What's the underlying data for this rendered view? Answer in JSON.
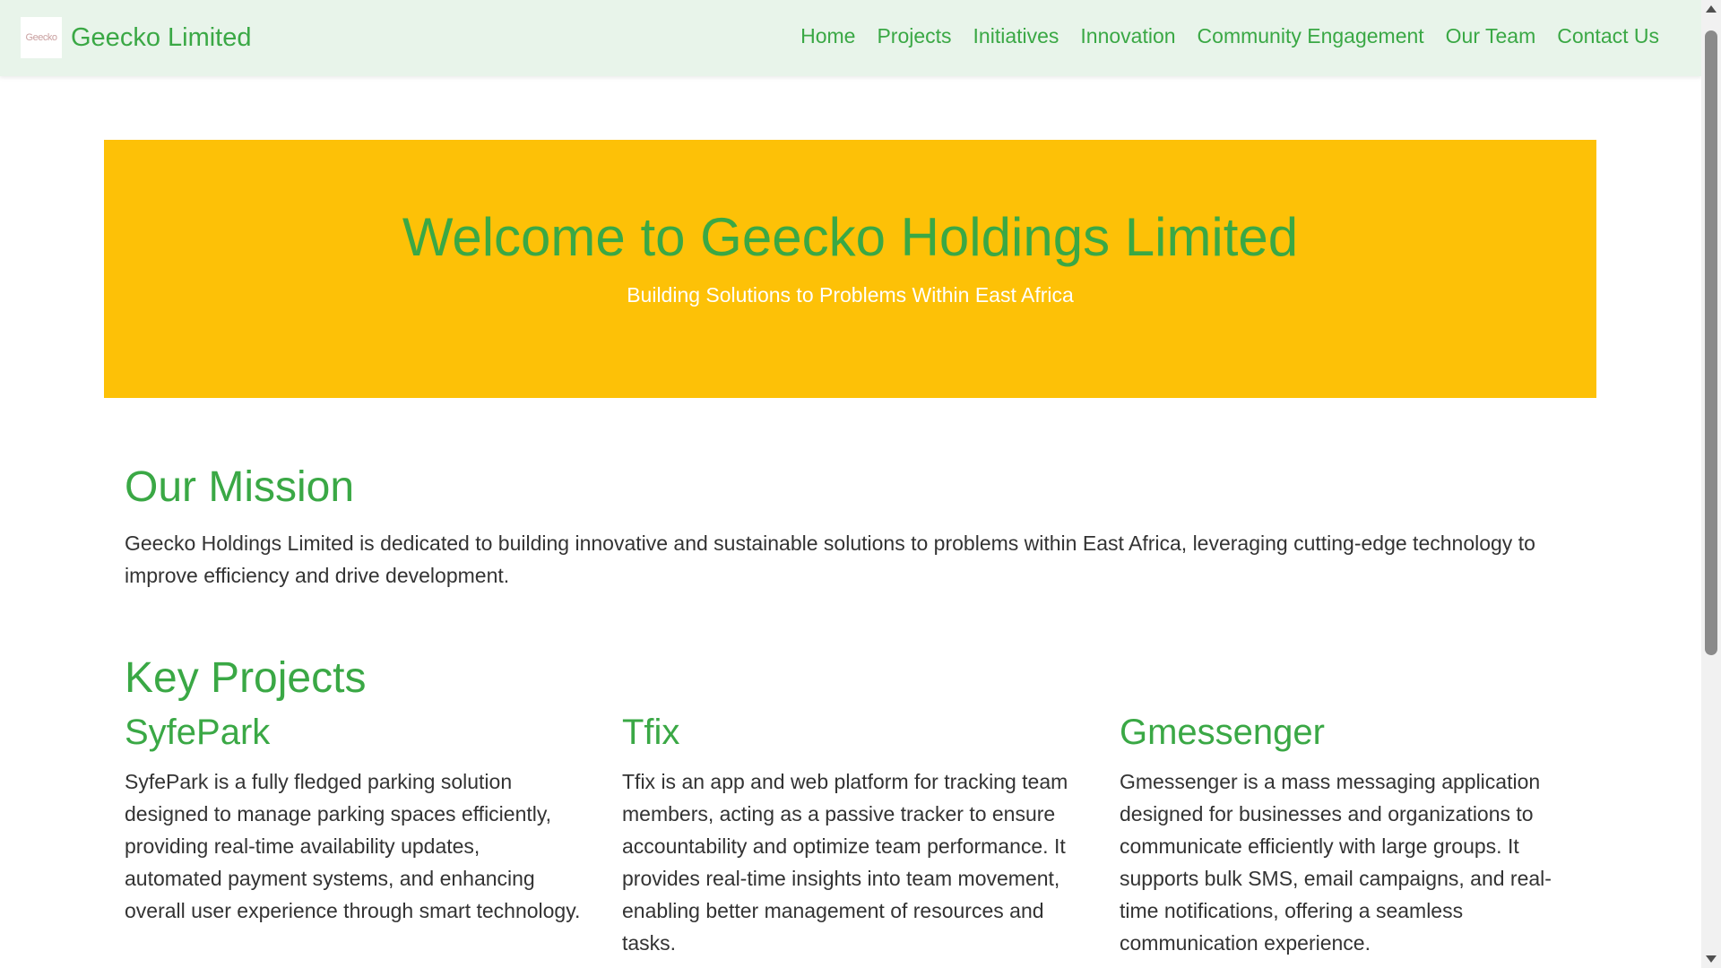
{
  "navbar": {
    "logo_text": "Geecko",
    "brand_name": "Geecko Limited",
    "links": [
      "Home",
      "Projects",
      "Initiatives",
      "Innovation",
      "Community Engagement",
      "Our Team",
      "Contact Us"
    ]
  },
  "hero": {
    "title": "Welcome to Geecko Holdings Limited",
    "subtitle": "Building Solutions to Problems Within East Africa"
  },
  "mission": {
    "title": "Our Mission",
    "text": "Geecko Holdings Limited is dedicated to building innovative and sustainable solutions to problems within East Africa, leveraging cutting-edge technology to improve efficiency and drive development."
  },
  "projects": {
    "title": "Key Projects",
    "items": [
      {
        "title": "SyfePark",
        "text": "SyfePark is a fully fledged parking solution designed to manage parking spaces efficiently, providing real-time availability updates, automated payment systems, and enhancing overall user experience through smart technology."
      },
      {
        "title": "Tfix",
        "text": "Tfix is an app and web platform for tracking team members, acting as a passive tracker to ensure accountability and optimize team performance. It provides real-time insights into team movement, enabling better management of resources and tasks."
      },
      {
        "title": "Gmessenger",
        "text": "Gmessenger is a mass messaging application designed for businesses and organizations to communicate efficiently with large groups. It supports bulk SMS, email campaigns, and real-time notifications, offering a seamless communication experience."
      }
    ]
  },
  "colors": {
    "brand_green": "#3aa845",
    "hero_yellow": "#fdc107",
    "navbar_bg": "#e8f4ea",
    "body_text": "#333333"
  }
}
